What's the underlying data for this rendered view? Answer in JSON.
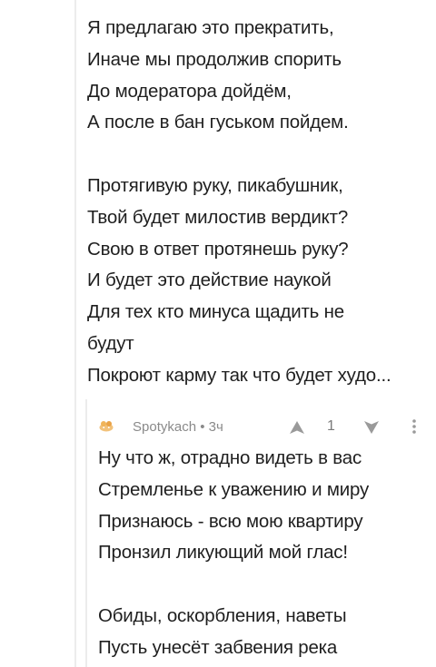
{
  "parent_comment": {
    "lines": [
      "Я предлагаю это прекратить,",
      "Иначе мы продолжив спорить",
      "До модератора дойдём,",
      "А после в бан гуськом пойдем.",
      "",
      "Протягивую руку, пикабушник,",
      "Твой будет милостив вердикт?",
      "Свою в ответ протянешь руку?",
      "И будет это действие наукой",
      "Для тех кто минуса щадить не",
      "будут",
      "Покроют карму так что будет худо..."
    ]
  },
  "reply_comment": {
    "author": "Spotykach",
    "separator": " • ",
    "time": "3ч",
    "rating": "1",
    "icons": {
      "avatar": "avatar-icon",
      "upvote": "arrow-up-icon",
      "downvote": "arrow-down-icon",
      "more": "more-vertical-icon"
    },
    "lines": [
      "Ну что ж, отрадно видеть в вас",
      "Стремленье к уважению и миру",
      "Признаюсь - всю мою квартиру",
      "Пронзил ликующий мой глас!",
      "",
      "Обиды, оскорбления, наветы",
      "Пусть унесёт забвения река"
    ]
  },
  "colors": {
    "text": "#1f1f1f",
    "meta": "#8a8a8a",
    "vote_icon": "#9a9a9a",
    "thread_line": "#ececec"
  }
}
